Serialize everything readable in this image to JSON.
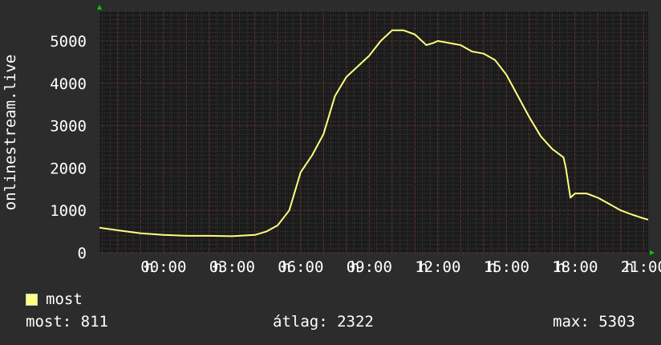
{
  "chart_data": {
    "type": "line",
    "ylabel": "onlinestream.live",
    "ylim": [
      0,
      5700
    ],
    "yticks": [
      0,
      1000,
      2000,
      3000,
      4000,
      5000
    ],
    "ytick_labels": [
      "0",
      "1000",
      "2000",
      "3000",
      "4000",
      "5000"
    ],
    "xlim": [
      -2.8,
      21.2
    ],
    "xticks": [
      0,
      3,
      6,
      9,
      12,
      15,
      18,
      21
    ],
    "xtick_labels": [
      "00:00",
      "03:00",
      "06:00",
      "09:00",
      "12:00",
      "15:00",
      "18:00",
      "21:00"
    ],
    "xtick_prefix": "h",
    "grid": true,
    "colors": {
      "background": "#2c2c2c",
      "plot_area": "#1b1b1b",
      "grid_minor": "#444444",
      "grid_major": "#6b2e2e",
      "series": "#ffff80",
      "axis_arrow": "#00cc00",
      "text": "#ffffff"
    },
    "series": [
      {
        "name": "most",
        "x": [
          -2.8,
          -2.0,
          -1.0,
          0.0,
          1.0,
          2.0,
          3.0,
          4.0,
          4.5,
          5.0,
          5.5,
          6.0,
          6.5,
          7.0,
          7.5,
          8.0,
          8.5,
          9.0,
          9.5,
          10.0,
          10.5,
          11.0,
          11.5,
          11.8,
          12.0,
          12.5,
          13.0,
          13.5,
          14.0,
          14.5,
          15.0,
          15.5,
          16.0,
          16.5,
          17.0,
          17.5,
          17.6,
          17.8,
          18.0,
          18.5,
          19.0,
          19.5,
          20.0,
          20.5,
          21.0,
          21.2
        ],
        "y": [
          590,
          530,
          460,
          420,
          400,
          400,
          390,
          420,
          500,
          650,
          1000,
          1900,
          2300,
          2800,
          3700,
          4150,
          4400,
          4650,
          5000,
          5250,
          5250,
          5150,
          4900,
          4950,
          5000,
          4950,
          4900,
          4750,
          4700,
          4550,
          4200,
          3700,
          3200,
          2750,
          2450,
          2250,
          2000,
          1300,
          1400,
          1400,
          1300,
          1150,
          1000,
          900,
          811,
          780
        ]
      }
    ]
  },
  "legend": [
    {
      "label": "most",
      "color": "#ffff80"
    }
  ],
  "stats": {
    "current": "most: 811",
    "average": "átlag: 2322",
    "max": "max: 5303"
  }
}
